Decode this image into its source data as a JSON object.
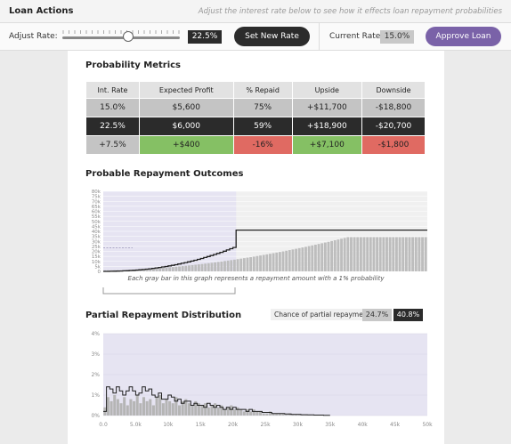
{
  "header": {
    "title": "Loan Actions",
    "hint": "Adjust the interest rate below to see how it effects loan repayment probabilities"
  },
  "controls": {
    "adjust_label": "Adjust Rate:",
    "slider_value": 0.56,
    "rate_value": "22.5%",
    "set_button": "Set New Rate",
    "current_label": "Current Rate:",
    "current_value": "15.0%",
    "approve_button": "Approve Loan"
  },
  "metrics": {
    "title": "Probability Metrics",
    "columns": [
      "Int. Rate",
      "Expected Profit",
      "% Repaid",
      "Upside",
      "Downside"
    ],
    "rows": [
      [
        "15.0%",
        "$5,600",
        "75%",
        "+$11,700",
        "-$18,800"
      ],
      [
        "22.5%",
        "$6,000",
        "59%",
        "+$18,900",
        "-$20,700"
      ],
      [
        "+7.5%",
        "+$400",
        "-16%",
        "+$7,100",
        "-$1,800"
      ]
    ]
  },
  "outcomes": {
    "title": "Probable Repayment Outcomes",
    "caption": "Each gray bar in this graph represents a repayment amount with a 1% probability"
  },
  "distribution": {
    "title": "Partial Repayment Distribution",
    "chance_label": "Chance of partial repayment:",
    "chance_current": "24.7%",
    "chance_new": "40.8%"
  },
  "chart_data": [
    {
      "type": "bar",
      "title": "Probable Repayment Outcomes",
      "y_ticks": [
        "0",
        "5k",
        "10k",
        "15k",
        "20k",
        "25k",
        "30k",
        "35k",
        "40k",
        "45k",
        "50k",
        "55k",
        "60k",
        "65k",
        "70k",
        "75k",
        "80k"
      ],
      "ylim": [
        0,
        80000
      ],
      "bars": 100,
      "current_full_repay_start": 75,
      "new_full_repay_start": 41,
      "full_amount_current": 34200,
      "full_amount_new": 41200,
      "reference_level": 23500
    },
    {
      "type": "bar",
      "title": "Partial Repayment Distribution",
      "x_ticks": [
        "0.0",
        "5.0k",
        "10k",
        "15k",
        "20k",
        "25k",
        "30k",
        "35k",
        "40k",
        "45k",
        "50k"
      ],
      "y_ticks": [
        "0%",
        "1%",
        "2%",
        "3%",
        "4%"
      ],
      "xlim": [
        0,
        50000
      ],
      "ylim": [
        0,
        4
      ],
      "bin_width": 500,
      "current_values": [
        0.4,
        0.9,
        0.7,
        1.0,
        0.8,
        0.6,
        0.9,
        0.5,
        0.8,
        0.7,
        1.0,
        0.6,
        0.9,
        0.7,
        0.8,
        0.5,
        0.9,
        1.0,
        0.6,
        0.8,
        0.7,
        0.6,
        0.9,
        0.5,
        0.7,
        0.8,
        0.6,
        0.5,
        0.7,
        0.6,
        0.5,
        0.6,
        0.4,
        0.5,
        0.6,
        0.4,
        0.5,
        0.3,
        0.4,
        0.5,
        0.3,
        0.4,
        0.3,
        0.2,
        0.3,
        0.2,
        0.3,
        0.2,
        0.2,
        0.1,
        0.1,
        0.2,
        0.1,
        0.1,
        0.1,
        0.1,
        0.05,
        0.1,
        0.05,
        0.05,
        0.04,
        0.03,
        0.02,
        0.02,
        0.01,
        0.01,
        0.01,
        0.01,
        0.01,
        0.01
      ],
      "new_values": [
        0.2,
        1.4,
        1.3,
        1.1,
        1.4,
        1.2,
        1.0,
        1.2,
        1.4,
        1.2,
        1.0,
        1.1,
        1.4,
        1.2,
        1.3,
        1.0,
        0.9,
        1.1,
        0.8,
        0.8,
        1.0,
        0.9,
        0.7,
        0.8,
        0.6,
        0.7,
        0.7,
        0.5,
        0.6,
        0.5,
        0.5,
        0.4,
        0.6,
        0.5,
        0.4,
        0.5,
        0.4,
        0.3,
        0.4,
        0.3,
        0.4,
        0.3,
        0.3,
        0.3,
        0.2,
        0.3,
        0.2,
        0.2,
        0.2,
        0.15,
        0.15,
        0.15,
        0.1,
        0.1,
        0.1,
        0.1,
        0.08,
        0.08,
        0.05,
        0.05,
        0.05,
        0.04,
        0.04,
        0.03,
        0.03,
        0.02,
        0.02,
        0.02,
        0.01,
        0.01
      ]
    }
  ]
}
